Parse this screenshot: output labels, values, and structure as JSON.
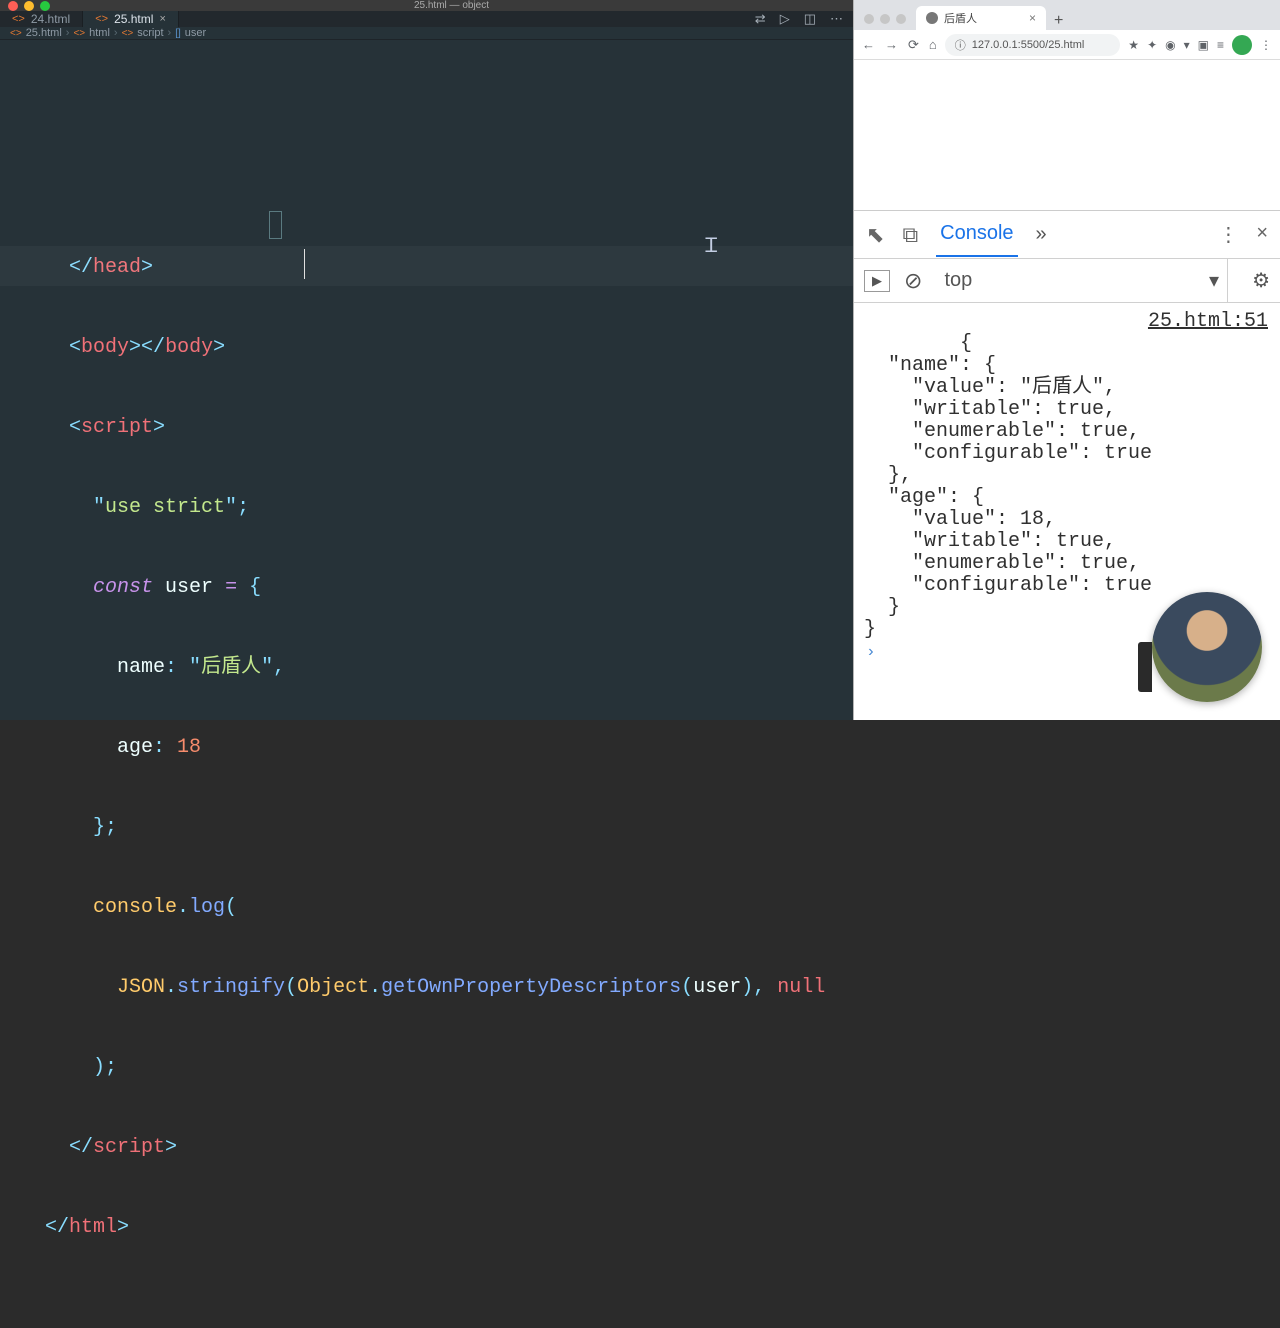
{
  "editor": {
    "windowTitle": "25.html — object",
    "tabs": [
      {
        "icon": "<>",
        "label": "24.html",
        "active": false,
        "closable": false
      },
      {
        "icon": "<>",
        "label": "25.html",
        "active": true,
        "closable": true
      }
    ],
    "toolbarIcons": [
      "⇄",
      "▷",
      "◫",
      "⋯"
    ],
    "breadcrumbs": [
      {
        "icon": "<>",
        "iconClass": "",
        "label": "25.html"
      },
      {
        "icon": "<>",
        "iconClass": "",
        "label": "html"
      },
      {
        "icon": "<>",
        "iconClass": "",
        "label": "script"
      },
      {
        "icon": "[]",
        "iconClass": "b",
        "label": "user"
      }
    ],
    "code": {
      "l1": {
        "open": "</",
        "name": "head",
        "close": ">"
      },
      "l2": {
        "o1": "<",
        "n1": "body",
        "c1": ">",
        "o2": "</",
        "n2": "body",
        "c2": ">"
      },
      "l3": {
        "open": "<",
        "name": "script",
        "close": ">"
      },
      "l4": {
        "q1": "\"",
        "s": "use strict",
        "q2": "\"",
        "semi": ";"
      },
      "l5": {
        "kw": "const",
        "var": "user",
        "eq": "=",
        "brace": "{"
      },
      "l6": {
        "attr": "name",
        "colon": ":",
        "q1": "\"",
        "str": "后盾人",
        "q2": "\"",
        "comma": ","
      },
      "l7": {
        "attr": "age",
        "colon": ":",
        "num": "18"
      },
      "l8": {
        "brace": "}",
        "semi": ";"
      },
      "l9": {
        "obj": "console",
        "dot": ".",
        "fn": "log",
        "paren": "("
      },
      "l10": {
        "obj1": "JSON",
        "dot1": ".",
        "fn1": "stringify",
        "p1": "(",
        "obj2": "Object",
        "dot2": ".",
        "fn2": "getOwnPropertyDescriptors",
        "p2": "(",
        "arg": "user",
        "p3": ")",
        "comma": ",",
        "null": "null"
      },
      "l11": {
        "paren": ")",
        "semi": ";"
      },
      "l12": {
        "open": "</",
        "name": "script",
        "close": ">"
      },
      "l13": {
        "open": "</",
        "name": "html",
        "close": ">"
      }
    }
  },
  "browser": {
    "tab": {
      "title": "后盾人",
      "close": "×"
    },
    "newTab": "+",
    "nav": {
      "back": "←",
      "fwd": "→",
      "reload": "⟳",
      "home": "⌂"
    },
    "address": "127.0.0.1:5500/25.html",
    "addrLock": "ⓘ",
    "menu": "⋮",
    "extIcons": [
      "★",
      "✦",
      "◉",
      "▾",
      "▣",
      "≡"
    ]
  },
  "devtools": {
    "inspect": "⬉",
    "device": "⧉",
    "tabs": {
      "console": "Console"
    },
    "more": "»",
    "kebab": "⋮",
    "close": "×",
    "play": "▶",
    "clear": "⊘",
    "context": "top",
    "contextChevron": "▾",
    "gear": "⚙",
    "sourceLink": "25.html:51",
    "output": "{\n  \"name\": {\n    \"value\": \"后盾人\",\n    \"writable\": true,\n    \"enumerable\": true,\n    \"configurable\": true\n  },\n  \"age\": {\n    \"value\": 18,\n    \"writable\": true,\n    \"enumerable\": true,\n    \"configurable\": true\n  }\n}",
    "prompt": "›"
  }
}
